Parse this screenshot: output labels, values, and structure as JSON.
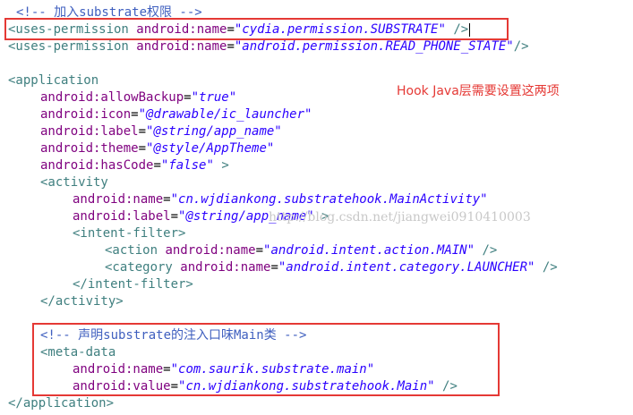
{
  "annotation": "Hook Java层需要设置这两项",
  "watermark": "http://blog.csdn.net/jiangwei0910410003",
  "highlight_color": "#e53935",
  "lines": [
    {
      "indent": 1,
      "tokens": [
        {
          "t": "<!-- 加入substrate权限 -->",
          "c": "com"
        }
      ]
    },
    {
      "indent": 0,
      "caret": true,
      "tokens": [
        {
          "t": "<uses-permission",
          "c": "tag"
        },
        {
          "t": " android:name",
          "c": "attr"
        },
        {
          "t": "=",
          "c": "pun"
        },
        {
          "t": "\"cydia.permission.SUBSTRATE\"",
          "c": "val"
        },
        {
          "t": " />",
          "c": "tag"
        }
      ]
    },
    {
      "indent": 0,
      "tokens": [
        {
          "t": "<uses-permission",
          "c": "tag"
        },
        {
          "t": " android:name",
          "c": "attr"
        },
        {
          "t": "=",
          "c": "pun"
        },
        {
          "t": "\"android.permission.READ_PHONE_STATE\"",
          "c": "val"
        },
        {
          "t": "/>",
          "c": "tag"
        }
      ]
    },
    {
      "indent": 0,
      "tokens": []
    },
    {
      "indent": 0,
      "tokens": [
        {
          "t": "<application",
          "c": "tag"
        }
      ]
    },
    {
      "indent": 4,
      "tokens": [
        {
          "t": "android:allowBackup",
          "c": "attr"
        },
        {
          "t": "=",
          "c": "pun"
        },
        {
          "t": "\"true\"",
          "c": "val"
        }
      ]
    },
    {
      "indent": 4,
      "tokens": [
        {
          "t": "android:icon",
          "c": "attr"
        },
        {
          "t": "=",
          "c": "pun"
        },
        {
          "t": "\"@drawable/ic_launcher\"",
          "c": "val"
        }
      ]
    },
    {
      "indent": 4,
      "tokens": [
        {
          "t": "android:label",
          "c": "attr"
        },
        {
          "t": "=",
          "c": "pun"
        },
        {
          "t": "\"@string/app_name\"",
          "c": "val"
        }
      ]
    },
    {
      "indent": 4,
      "tokens": [
        {
          "t": "android:theme",
          "c": "attr"
        },
        {
          "t": "=",
          "c": "pun"
        },
        {
          "t": "\"@style/AppTheme\"",
          "c": "val"
        }
      ]
    },
    {
      "indent": 4,
      "tokens": [
        {
          "t": "android:hasCode",
          "c": "attr"
        },
        {
          "t": "=",
          "c": "pun"
        },
        {
          "t": "\"false\"",
          "c": "val"
        },
        {
          "t": " >",
          "c": "tag"
        }
      ]
    },
    {
      "indent": 4,
      "tokens": [
        {
          "t": "<activity",
          "c": "tag"
        }
      ]
    },
    {
      "indent": 8,
      "tokens": [
        {
          "t": "android:name",
          "c": "attr"
        },
        {
          "t": "=",
          "c": "pun"
        },
        {
          "t": "\"cn.wjdiankong.substratehook.MainActivity\"",
          "c": "val"
        }
      ]
    },
    {
      "indent": 8,
      "tokens": [
        {
          "t": "android:label",
          "c": "attr"
        },
        {
          "t": "=",
          "c": "pun"
        },
        {
          "t": "\"@string/app_name\"",
          "c": "val"
        },
        {
          "t": " >",
          "c": "tag"
        }
      ]
    },
    {
      "indent": 8,
      "tokens": [
        {
          "t": "<intent-filter>",
          "c": "tag"
        }
      ]
    },
    {
      "indent": 12,
      "tokens": [
        {
          "t": "<action",
          "c": "tag"
        },
        {
          "t": " android:name",
          "c": "attr"
        },
        {
          "t": "=",
          "c": "pun"
        },
        {
          "t": "\"android.intent.action.MAIN\"",
          "c": "val"
        },
        {
          "t": " />",
          "c": "tag"
        }
      ]
    },
    {
      "indent": 12,
      "tokens": [
        {
          "t": "<category",
          "c": "tag"
        },
        {
          "t": " android:name",
          "c": "attr"
        },
        {
          "t": "=",
          "c": "pun"
        },
        {
          "t": "\"android.intent.category.LAUNCHER\"",
          "c": "val"
        },
        {
          "t": " />",
          "c": "tag"
        }
      ]
    },
    {
      "indent": 8,
      "tokens": [
        {
          "t": "</intent-filter>",
          "c": "tag"
        }
      ]
    },
    {
      "indent": 4,
      "tokens": [
        {
          "t": "</activity>",
          "c": "tag"
        }
      ]
    },
    {
      "indent": 0,
      "tokens": []
    },
    {
      "indent": 4,
      "tokens": [
        {
          "t": "<!-- 声明substrate的注入口味Main类 -->",
          "c": "com"
        }
      ]
    },
    {
      "indent": 4,
      "tokens": [
        {
          "t": "<meta-data",
          "c": "tag"
        }
      ]
    },
    {
      "indent": 8,
      "tokens": [
        {
          "t": "android:name",
          "c": "attr"
        },
        {
          "t": "=",
          "c": "pun"
        },
        {
          "t": "\"com.saurik.substrate.main\"",
          "c": "val"
        }
      ]
    },
    {
      "indent": 8,
      "tokens": [
        {
          "t": "android:value",
          "c": "attr"
        },
        {
          "t": "=",
          "c": "pun"
        },
        {
          "t": "\"cn.wjdiankong.substratehook.Main\"",
          "c": "val"
        },
        {
          "t": " />",
          "c": "tag"
        }
      ]
    },
    {
      "indent": 0,
      "tokens": [
        {
          "t": "</application>",
          "c": "tag"
        }
      ]
    }
  ]
}
